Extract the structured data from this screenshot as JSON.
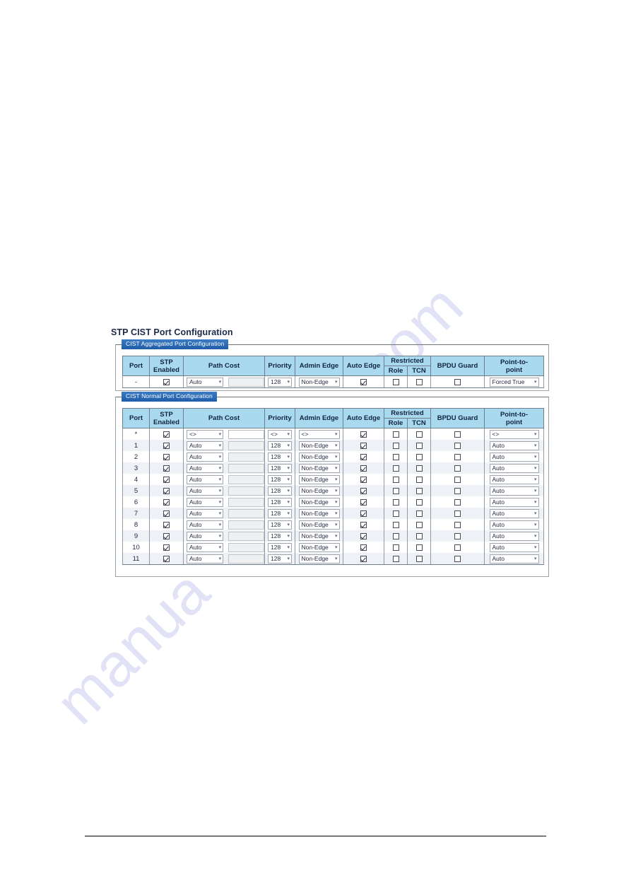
{
  "page": {
    "title": "STP CIST Port Configuration",
    "watermark_line_1": "com",
    "watermark_line_2": "manua"
  },
  "colors": {
    "header_bg": "#a9d9ef",
    "legend_bg": "#2a6ab8",
    "legend_fg": "#ffffff",
    "row_alt_bg": "#eef2f7",
    "title_fg": "#1b2a4a"
  },
  "columns": {
    "port": "Port",
    "stp_enabled_line1": "STP",
    "stp_enabled_line2": "Enabled",
    "path_cost": "Path Cost",
    "priority": "Priority",
    "admin_edge": "Admin Edge",
    "auto_edge": "Auto Edge",
    "restricted": "Restricted",
    "restricted_role": "Role",
    "restricted_tcn": "TCN",
    "bpdu_guard": "BPDU Guard",
    "point_to_point_line1": "Point-to-",
    "point_to_point_line2": "point"
  },
  "aggregated": {
    "legend": "CIST Aggregated Port Configuration",
    "rows": [
      {
        "port": "-",
        "stp_enabled": true,
        "path_cost_select": "Auto",
        "path_cost_value": "",
        "path_cost_editable": false,
        "priority": "128",
        "admin_edge": "Non-Edge",
        "auto_edge": true,
        "restricted_role": false,
        "restricted_tcn": false,
        "bpdu_guard": false,
        "point_to_point": "Forced True"
      }
    ]
  },
  "normal": {
    "legend": "CIST Normal Port Configuration",
    "rows": [
      {
        "port": "*",
        "stp_enabled": true,
        "path_cost_select": "<>",
        "path_cost_value": "",
        "path_cost_editable": true,
        "priority": "<>",
        "admin_edge": "<>",
        "auto_edge": true,
        "restricted_role": false,
        "restricted_tcn": false,
        "bpdu_guard": false,
        "point_to_point": "<>"
      },
      {
        "port": "1",
        "stp_enabled": true,
        "path_cost_select": "Auto",
        "path_cost_value": "",
        "path_cost_editable": false,
        "priority": "128",
        "admin_edge": "Non-Edge",
        "auto_edge": true,
        "restricted_role": false,
        "restricted_tcn": false,
        "bpdu_guard": false,
        "point_to_point": "Auto"
      },
      {
        "port": "2",
        "stp_enabled": true,
        "path_cost_select": "Auto",
        "path_cost_value": "",
        "path_cost_editable": false,
        "priority": "128",
        "admin_edge": "Non-Edge",
        "auto_edge": true,
        "restricted_role": false,
        "restricted_tcn": false,
        "bpdu_guard": false,
        "point_to_point": "Auto"
      },
      {
        "port": "3",
        "stp_enabled": true,
        "path_cost_select": "Auto",
        "path_cost_value": "",
        "path_cost_editable": false,
        "priority": "128",
        "admin_edge": "Non-Edge",
        "auto_edge": true,
        "restricted_role": false,
        "restricted_tcn": false,
        "bpdu_guard": false,
        "point_to_point": "Auto"
      },
      {
        "port": "4",
        "stp_enabled": true,
        "path_cost_select": "Auto",
        "path_cost_value": "",
        "path_cost_editable": false,
        "priority": "128",
        "admin_edge": "Non-Edge",
        "auto_edge": true,
        "restricted_role": false,
        "restricted_tcn": false,
        "bpdu_guard": false,
        "point_to_point": "Auto"
      },
      {
        "port": "5",
        "stp_enabled": true,
        "path_cost_select": "Auto",
        "path_cost_value": "",
        "path_cost_editable": false,
        "priority": "128",
        "admin_edge": "Non-Edge",
        "auto_edge": true,
        "restricted_role": false,
        "restricted_tcn": false,
        "bpdu_guard": false,
        "point_to_point": "Auto"
      },
      {
        "port": "6",
        "stp_enabled": true,
        "path_cost_select": "Auto",
        "path_cost_value": "",
        "path_cost_editable": false,
        "priority": "128",
        "admin_edge": "Non-Edge",
        "auto_edge": true,
        "restricted_role": false,
        "restricted_tcn": false,
        "bpdu_guard": false,
        "point_to_point": "Auto"
      },
      {
        "port": "7",
        "stp_enabled": true,
        "path_cost_select": "Auto",
        "path_cost_value": "",
        "path_cost_editable": false,
        "priority": "128",
        "admin_edge": "Non-Edge",
        "auto_edge": true,
        "restricted_role": false,
        "restricted_tcn": false,
        "bpdu_guard": false,
        "point_to_point": "Auto"
      },
      {
        "port": "8",
        "stp_enabled": true,
        "path_cost_select": "Auto",
        "path_cost_value": "",
        "path_cost_editable": false,
        "priority": "128",
        "admin_edge": "Non-Edge",
        "auto_edge": true,
        "restricted_role": false,
        "restricted_tcn": false,
        "bpdu_guard": false,
        "point_to_point": "Auto"
      },
      {
        "port": "9",
        "stp_enabled": true,
        "path_cost_select": "Auto",
        "path_cost_value": "",
        "path_cost_editable": false,
        "priority": "128",
        "admin_edge": "Non-Edge",
        "auto_edge": true,
        "restricted_role": false,
        "restricted_tcn": false,
        "bpdu_guard": false,
        "point_to_point": "Auto"
      },
      {
        "port": "10",
        "stp_enabled": true,
        "path_cost_select": "Auto",
        "path_cost_value": "",
        "path_cost_editable": false,
        "priority": "128",
        "admin_edge": "Non-Edge",
        "auto_edge": true,
        "restricted_role": false,
        "restricted_tcn": false,
        "bpdu_guard": false,
        "point_to_point": "Auto"
      },
      {
        "port": "11",
        "stp_enabled": true,
        "path_cost_select": "Auto",
        "path_cost_value": "",
        "path_cost_editable": false,
        "priority": "128",
        "admin_edge": "Non-Edge",
        "auto_edge": true,
        "restricted_role": false,
        "restricted_tcn": false,
        "bpdu_guard": false,
        "point_to_point": "Auto"
      }
    ]
  }
}
